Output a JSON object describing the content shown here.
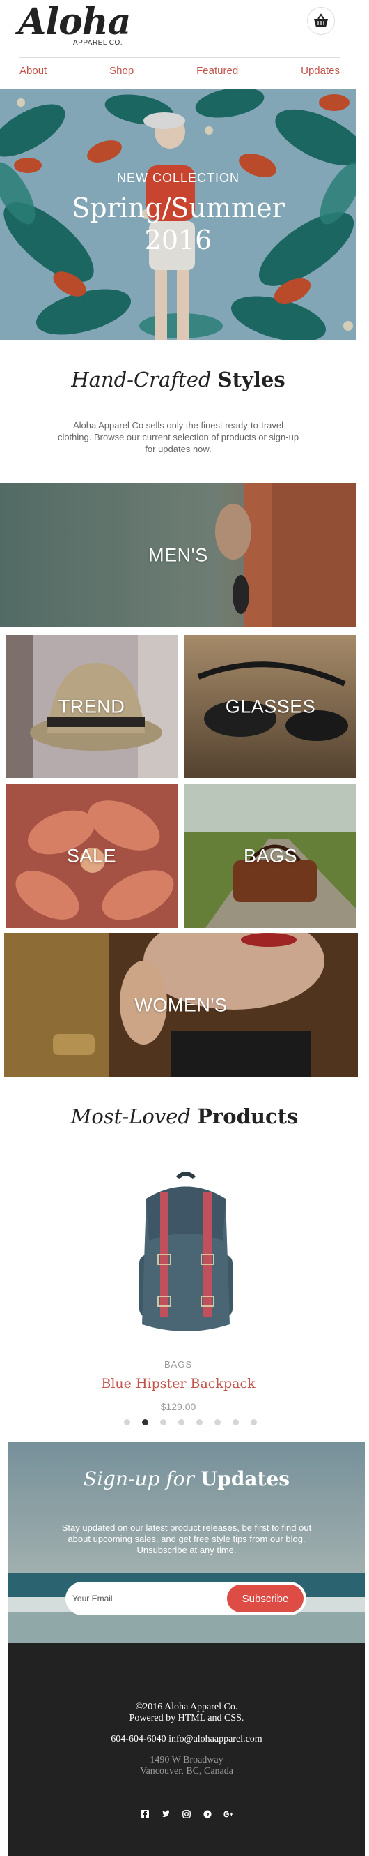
{
  "header": {
    "logo": "Aloha",
    "logo_sub": "APPAREL CO.",
    "cart_icon": "basket-icon"
  },
  "nav": {
    "items": [
      "About",
      "Shop",
      "Featured",
      "Updates"
    ]
  },
  "hero": {
    "kicker": "NEW COLLECTION",
    "title_line1": "Spring/Summer",
    "title_line2": "2016"
  },
  "intro": {
    "title_italic": "Hand-Crafted",
    "title_bold": "Styles",
    "text": "Aloha Apparel Co sells only the finest ready-to-travel clothing. Browse our current selection of products or sign-up for updates now."
  },
  "categories": [
    "MEN'S",
    "TREND",
    "GLASSES",
    "SALE",
    "BAGS",
    "WOMEN'S"
  ],
  "products": {
    "title_italic": "Most-Loved",
    "title_bold": "Products",
    "category": "BAGS",
    "name": "Blue Hipster Backpack",
    "price": "$129.00",
    "slide_count": 8,
    "active_slide": 2
  },
  "signup": {
    "title_italic": "Sign-up for",
    "title_bold": "Updates",
    "text": "Stay updated on our latest product releases, be first to find out about upcoming sales, and get free style tips from our blog. Unsubscribe at any time.",
    "placeholder": "Your Email",
    "button": "Subscribe"
  },
  "footer": {
    "copyright": "©2016 Aloha Apparel Co.",
    "powered": "Powered by HTML and CSS.",
    "contact": "604-604-6040 info@alohaapparel.com",
    "address1": "1490 W Broadway",
    "address2": "Vancouver, BC, Canada",
    "socials": [
      "facebook-icon",
      "twitter-icon",
      "instagram-icon",
      "pinterest-icon",
      "google-plus-icon"
    ]
  },
  "colors": {
    "accent": "#c2544b",
    "subscribe": "#dd4c45",
    "footer": "#222222"
  }
}
